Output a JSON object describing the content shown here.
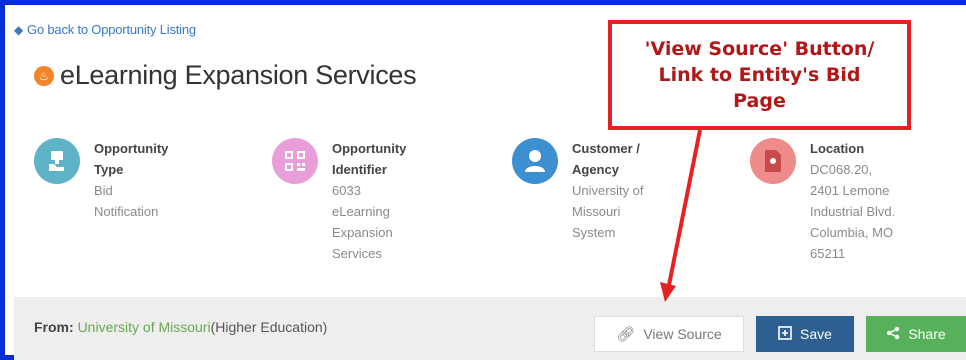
{
  "nav": {
    "back_label": "Go back to Opportunity Listing"
  },
  "title": "eLearning Expansion Services",
  "info": [
    {
      "label": "Opportunity\nType",
      "value": "Bid\nNotification",
      "icon": "thumbs-up-icon",
      "color": "#5fb3c9"
    },
    {
      "label": "Opportunity\nIdentifier",
      "value": "6033\neLearning\nExpansion\nServices",
      "icon": "qr-code-icon",
      "color": "#e89fd9"
    },
    {
      "label": "Customer /\nAgency",
      "value": "University of\nMissouri\nSystem",
      "icon": "user-icon",
      "color": "#3c8fd0"
    },
    {
      "label": "Location",
      "value": "DC068.20,\n2401 Lemone\nIndustrial Blvd.\nColumbia, MO\n65211",
      "icon": "document-icon",
      "color": "#ee8b8b"
    }
  ],
  "from_bar": {
    "from_label": "From:",
    "org_name": "University of Missouri",
    "org_type": "(Higher Education)"
  },
  "buttons": {
    "view_source": "View Source",
    "save": "Save",
    "share": "Share"
  },
  "callout": {
    "text": "'View Source' Button/ Link to Entity's Bid Page",
    "color": "#e32222"
  }
}
